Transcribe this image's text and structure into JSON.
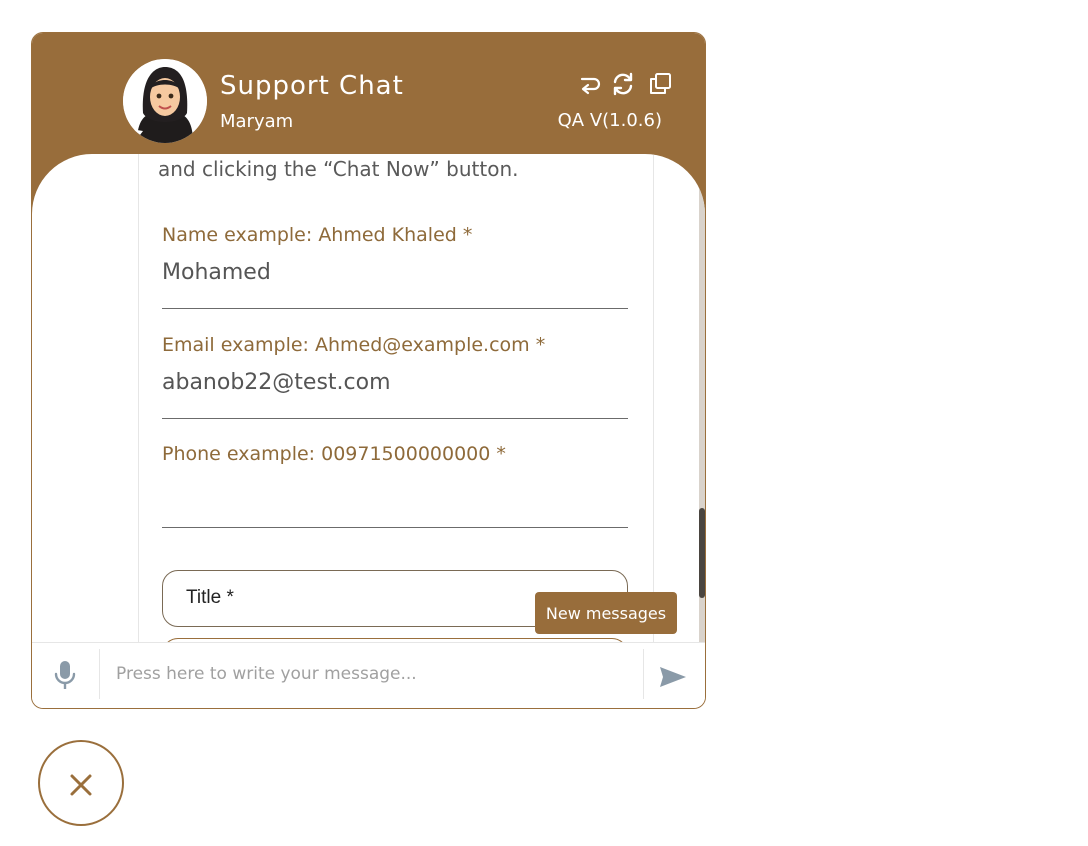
{
  "header": {
    "title": "Support Chat",
    "agent_name": "Maryam",
    "version": "QA V(1.0.6)",
    "icons": [
      "return-icon",
      "refresh-icon",
      "popout-icon"
    ]
  },
  "message": {
    "text_fragment": "and clicking the “Chat Now” button."
  },
  "form": {
    "name": {
      "label": "Name example: Ahmed Khaled *",
      "value": "Mohamed"
    },
    "email": {
      "label": "Email example: Ahmed@example.com *",
      "value": "abanob22@test.com"
    },
    "phone": {
      "label": "Phone example: 00971500000000 *",
      "value": ""
    },
    "title": {
      "label": "Title *"
    }
  },
  "new_messages_label": "New messages",
  "composer": {
    "placeholder": "Press here to write your message..."
  },
  "colors": {
    "brand": "#986d3b",
    "label": "#8e6a3a",
    "icon_gray": "#8a9aa8"
  }
}
